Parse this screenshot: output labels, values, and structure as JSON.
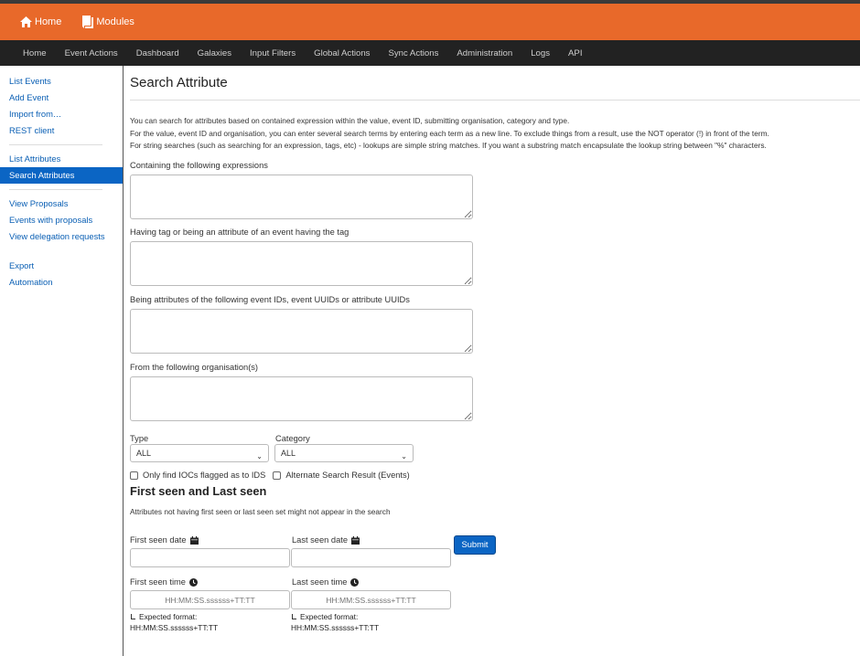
{
  "topbar": {
    "home_label": "Home",
    "modules_label": "Modules"
  },
  "nav": {
    "items": [
      "Home",
      "Event Actions",
      "Dashboard",
      "Galaxies",
      "Input Filters",
      "Global Actions",
      "Sync Actions",
      "Administration",
      "Logs",
      "API"
    ]
  },
  "sidebar": {
    "group1": [
      "List Events",
      "Add Event",
      "Import from…",
      "REST client"
    ],
    "group2": [
      "List Attributes",
      "Search Attributes"
    ],
    "group3": [
      "View Proposals",
      "Events with proposals",
      "View delegation requests"
    ],
    "group4": [
      "Export",
      "Automation"
    ],
    "active": "Search Attributes"
  },
  "page": {
    "title": "Search Attribute",
    "intro_lines": [
      "You can search for attributes based on contained expression within the value, event ID, submitting organisation, category and type.",
      "For the value, event ID and organisation, you can enter several search terms by entering each term as a new line. To exclude things from a result, use the NOT operator (!) in front of the term.",
      "For string searches (such as searching for an expression, tags, etc) - lookups are simple string matches. If you want a substring match encapsulate the lookup string between \"%\" characters."
    ]
  },
  "form": {
    "expressions_label": "Containing the following expressions",
    "tag_label": "Having tag or being an attribute of an event having the tag",
    "ids_label": "Being attributes of the following event IDs, event UUIDs or attribute UUIDs",
    "org_label": "From the following organisation(s)",
    "type_label": "Type",
    "type_value": "ALL",
    "category_label": "Category",
    "category_value": "ALL",
    "ioc_label": "Only find IOCs flagged as to IDS",
    "alt_label": "Alternate Search Result (Events)",
    "seen_heading": "First seen and Last seen",
    "seen_note": "Attributes not having first seen or last seen set might not appear in the search",
    "first_seen_date_label": "First seen date",
    "last_seen_date_label": "Last seen date",
    "first_seen_time_label": "First seen time",
    "last_seen_time_label": "Last seen time",
    "time_placeholder": "HH:MM:SS.ssssss+TT:TT",
    "expected_format_label": "Expected format:",
    "expected_format_value": "HH:MM:SS.ssssss+TT:TT",
    "submit_label": "Submit"
  },
  "colors": {
    "topbar": "#e8692a",
    "navbar": "#222222",
    "accent": "#0b65c4"
  }
}
